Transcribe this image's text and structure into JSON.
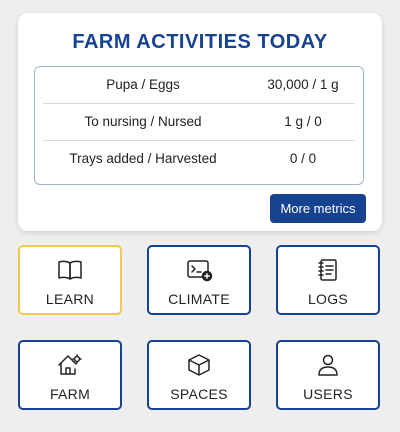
{
  "panel": {
    "title": "FARM ACTIVITIES TODAY",
    "metrics": [
      {
        "label": "Pupa / Eggs",
        "value": "30,000 / 1 g"
      },
      {
        "label": "To nursing / Nursed",
        "value": "1 g / 0"
      },
      {
        "label": "Trays added / Harvested",
        "value": "0 / 0"
      }
    ],
    "more_button": "More metrics"
  },
  "tiles": [
    {
      "label": "LEARN",
      "icon": "book-icon",
      "selected": true
    },
    {
      "label": "CLIMATE",
      "icon": "terminal-add-icon",
      "selected": false
    },
    {
      "label": "LOGS",
      "icon": "notebook-icon",
      "selected": false
    },
    {
      "label": "FARM",
      "icon": "house-gear-icon",
      "selected": false
    },
    {
      "label": "SPACES",
      "icon": "box-icon",
      "selected": false
    },
    {
      "label": "USERS",
      "icon": "user-icon",
      "selected": false
    }
  ],
  "colors": {
    "brand": "#17428f",
    "selected_border": "#f2c94c",
    "background": "#eeeeee"
  }
}
